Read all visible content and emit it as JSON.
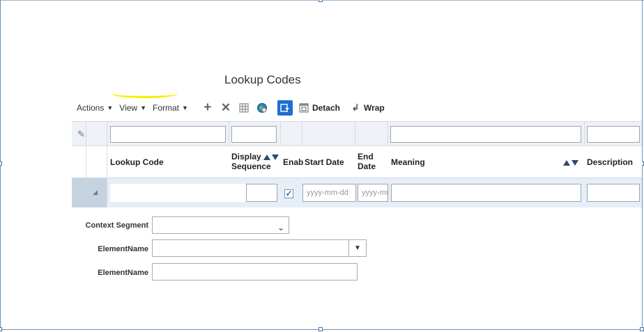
{
  "page": {
    "title": "Lookup Codes"
  },
  "toolbar": {
    "actions_label": "Actions",
    "view_label": "View",
    "format_label": "Format",
    "detach_label": "Detach",
    "wrap_label": "Wrap",
    "icons": [
      "add-icon",
      "delete-icon",
      "freeze-icon",
      "web-service-icon",
      "query-by-example-icon",
      "detach-icon",
      "wrap-icon"
    ]
  },
  "table": {
    "columns": {
      "lookup_code": "Lookup Code",
      "display_sequence_line1": "Display",
      "display_sequence_line2": "Sequence",
      "enabled": "Enab",
      "start_date": "Start Date",
      "end_date_line1": "End",
      "end_date_line2": "Date",
      "meaning": "Meaning",
      "description": "Description"
    },
    "row": {
      "lookup_code": "",
      "display_sequence": "",
      "enabled": true,
      "start_date_placeholder": "yyyy-mm-dd",
      "end_date_placeholder": "yyyy-mm",
      "meaning": "",
      "description": ""
    }
  },
  "form": {
    "context_segment_label": "Context Segment",
    "context_segment_value": "",
    "element_name_label_1": "ElementName",
    "element_name_value_1": "",
    "element_name_label_2": "ElementName",
    "element_name_value_2": ""
  },
  "colors": {
    "accent": "#1e6fd0",
    "selected_row": "#e6eef8",
    "highlight": "#f5f000"
  }
}
